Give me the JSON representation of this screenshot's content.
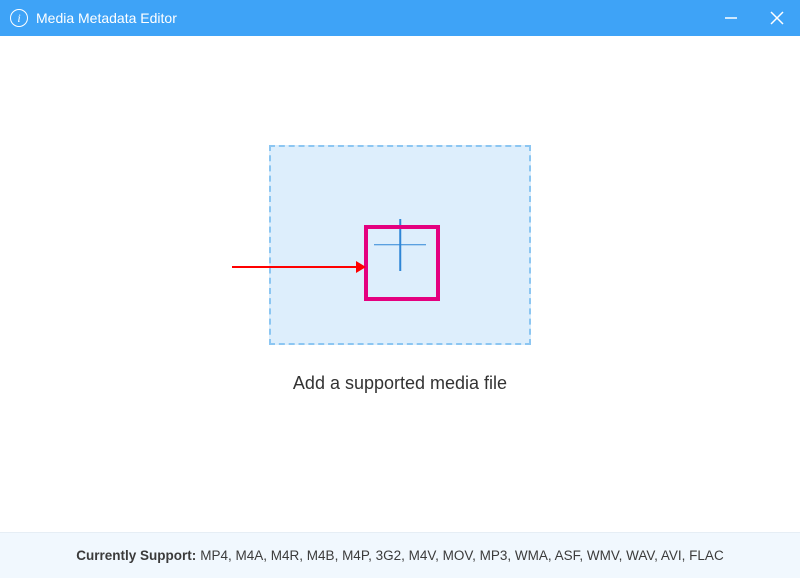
{
  "titlebar": {
    "title": "Media Metadata Editor"
  },
  "main": {
    "prompt": "Add a supported media file"
  },
  "footer": {
    "label": "Currently Support:",
    "formats": "MP4, M4A, M4R, M4B, M4P, 3G2, M4V, MOV, MP3, WMA, ASF, WMV, WAV, AVI, FLAC"
  }
}
